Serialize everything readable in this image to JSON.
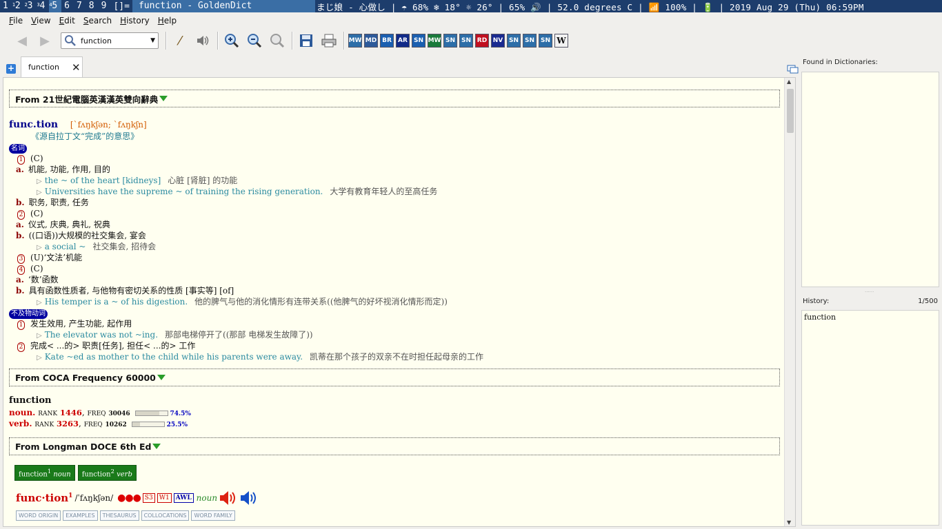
{
  "topbar": {
    "workspaces": [
      {
        "label": "1",
        "sup": ""
      },
      {
        "label": "2",
        "sup": "1"
      },
      {
        "label": "3",
        "sup": "2"
      },
      {
        "label": "4",
        "sup": "3"
      },
      {
        "label": "5",
        "sup": "4",
        "current": true
      },
      {
        "label": "6",
        "sup": ""
      },
      {
        "label": "7",
        "sup": ""
      },
      {
        "label": "8",
        "sup": ""
      },
      {
        "label": "9",
        "sup": ""
      }
    ],
    "layout": "[]=",
    "window_title": "function - GoldenDict",
    "status": "まじ娘 - 心做し | ☂ 68% ❄ 18° ☼ 26° | 65% 🔊 | 52.0 degrees C | 📶 100% | 🔋 | 2019 Aug 29 (Thu) 06:59PM"
  },
  "menubar": {
    "items": [
      "File",
      "Edit",
      "Search",
      "History",
      "Help"
    ],
    "view": "View"
  },
  "toolbar": {
    "search_value": "function",
    "dict_icons": [
      "MW",
      "MD",
      "BR",
      "AR",
      "SN",
      "MW",
      "SN",
      "SN",
      "RD",
      "NV",
      "SN",
      "SN",
      "SN",
      "W"
    ]
  },
  "tab": {
    "label": "function"
  },
  "article": {
    "sec1": {
      "title": "From 21世紀電腦英漢漢英雙向辭典",
      "headword": "func.tion",
      "phonetic": "[ˋfʌŋkʃən; ˋfʌŋkʃn]",
      "etymology": "《源自拉丁文“完成”的意思》",
      "pos1": "名词",
      "pos2": "不及物动词",
      "lines": [
        {
          "kind": "num",
          "n": "1",
          "text": "(C)"
        },
        {
          "kind": "letter",
          "l": "a.",
          "text": "机能, 功能, 作用, 目的"
        },
        {
          "kind": "ex",
          "en": "the ~ of the heart [kidneys]",
          "zh": "心脏 [肾脏] 的功能"
        },
        {
          "kind": "ex",
          "en": "Universities have the supreme ~ of training the rising generation.",
          "zh": "大学有教育年轻人的至高任务"
        },
        {
          "kind": "letter",
          "l": "b.",
          "text": "职务, 职责, 任务"
        },
        {
          "kind": "num",
          "n": "2",
          "text": "(C)"
        },
        {
          "kind": "letter",
          "l": "a.",
          "text": "仪式, 庆典, 典礼, 祝典"
        },
        {
          "kind": "letter",
          "l": "b.",
          "text": "((口语))大规模的社交集会, 宴会"
        },
        {
          "kind": "ex",
          "en": "a social ~",
          "zh": "社交集会, 招待会"
        },
        {
          "kind": "num",
          "n": "3",
          "text": "(U)‘文法’机能"
        },
        {
          "kind": "num",
          "n": "4",
          "text": "(C)"
        },
        {
          "kind": "letter",
          "l": "a.",
          "text": "‘数’函数"
        },
        {
          "kind": "letter",
          "l": "b.",
          "text": "具有函数性质者, 与他物有密切关系的性质 [事实等] [of]"
        },
        {
          "kind": "ex",
          "en": "His temper is a ~ of his digestion.",
          "zh": "他的脾气与他的消化情形有连带关系((他脾气的好坏视消化情形而定))"
        }
      ],
      "lines2": [
        {
          "kind": "num",
          "n": "1",
          "text": "发生效用, 产生功能, 起作用"
        },
        {
          "kind": "ex",
          "en": "The elevator was not ~ing.",
          "zh": "那部电梯停开了((那部 电梯发生故障了))"
        },
        {
          "kind": "num",
          "n": "2",
          "text": "完成< ...的> 职责[任务], 担任< ...的> 工作"
        },
        {
          "kind": "ex",
          "en": "Kate ~ed as mother to the child while his parents were away.",
          "zh": "凯蒂在那个孩子的双亲不在时担任起母亲的工作"
        }
      ]
    },
    "sec2": {
      "title": "From COCA Frequency 60000",
      "word": "function",
      "rows": [
        {
          "pos": "noun.",
          "rank_lbl": "RANK",
          "rank": "1446",
          "freq_lbl": "FREQ",
          "freq": "30046",
          "pct": "74.5%",
          "share": 0.745
        },
        {
          "pos": "verb.",
          "rank_lbl": "RANK",
          "rank": "3263",
          "freq_lbl": "FREQ",
          "freq": "10262",
          "pct": "25.5%",
          "share": 0.255
        }
      ]
    },
    "sec3": {
      "title": "From Longman DOCE 6th Ed",
      "btn1": "function",
      "btn1_sup": "1",
      "btn1_pos": "noun",
      "btn2": "function",
      "btn2_sup": "2",
      "btn2_pos": "verb",
      "hw": "func·tion",
      "hw_sup": "1",
      "pron": "/ˈfʌŋkʃən/",
      "dots": "●●●",
      "labels": [
        "S3",
        "W1"
      ],
      "awl": "AWL",
      "pos": "noun",
      "tabs": [
        "WORD ORIGIN",
        "EXAMPLES",
        "THESAURUS",
        "COLLOCATIONS",
        "WORD FAMILY"
      ]
    }
  },
  "right": {
    "found_label": "Found in Dictionaries:",
    "history_label": "History:",
    "history_count": "1/500",
    "history_items": [
      "function"
    ]
  }
}
